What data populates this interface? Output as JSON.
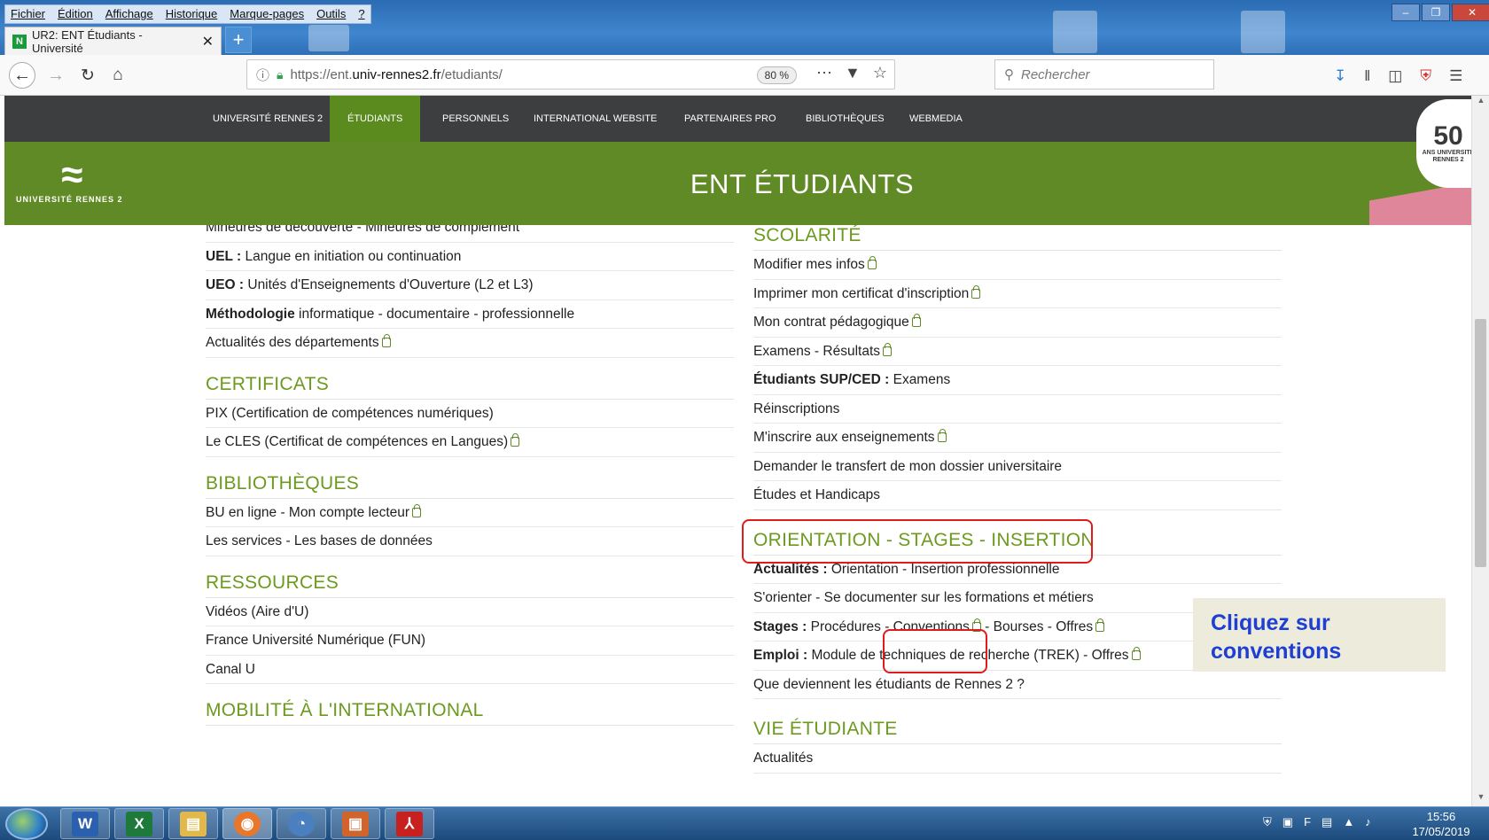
{
  "menu": [
    "Fichier",
    "Édition",
    "Affichage",
    "Historique",
    "Marque-pages",
    "Outils",
    "?"
  ],
  "tab": {
    "title": "UR2: ENT Étudiants - Université",
    "favicon": "N",
    "close": "✕"
  },
  "newtab": "+",
  "window_controls": [
    "–",
    "❐",
    "✕"
  ],
  "urlbar": {
    "scheme": "https://ent.",
    "host": "univ-rennes2.fr",
    "path": "/etudiants/",
    "zoom": "80 %"
  },
  "search_placeholder": "Rechercher",
  "sitenav": [
    "UNIVERSITÉ RENNES 2",
    "ÉTUDIANTS",
    "PERSONNELS",
    "INTERNATIONAL WEBSITE",
    "PARTENAIRES PRO",
    "BIBLIOTHÈQUES",
    "WEBMEDIA"
  ],
  "banner": {
    "title": "ENT ÉTUDIANTS",
    "logo_text": "UNIVERSITÉ RENNES 2",
    "badge_number": "50",
    "badge_text": "ANS UNIVERSITÉ RENNES 2"
  },
  "left": {
    "top_rows": [
      {
        "bold": "",
        "text": "Mineures de découverte - Mineures de complément",
        "lock": false
      },
      {
        "bold": "UEL :",
        "text": " Langue en initiation ou continuation",
        "lock": false
      },
      {
        "bold": "UEO :",
        "text": " Unités d'Enseignements d'Ouverture (L2 et L3)",
        "lock": false
      },
      {
        "bold": "Méthodologie",
        "text": " informatique - documentaire - professionnelle",
        "lock": false
      },
      {
        "bold": "",
        "text": "Actualités des départements",
        "lock": true
      }
    ],
    "certificats": {
      "heading": "CERTIFICATS",
      "rows": [
        {
          "bold": "",
          "text": "PIX (Certification de compétences numériques)",
          "lock": false
        },
        {
          "bold": "",
          "text": "Le CLES (Certificat de compétences en Langues)",
          "lock": true
        }
      ]
    },
    "bibliotheques": {
      "heading": "BIBLIOTHÈQUES",
      "rows": [
        {
          "bold": "",
          "text": "BU en ligne - Mon compte lecteur",
          "lock": true
        },
        {
          "bold": "",
          "text": "Les services - Les bases de données",
          "lock": false
        }
      ]
    },
    "ressources": {
      "heading": "RESSOURCES",
      "rows": [
        {
          "bold": "",
          "text": "Vidéos (Aire d'U)",
          "lock": false
        },
        {
          "bold": "",
          "text": "France Université Numérique (FUN)",
          "lock": false
        },
        {
          "bold": "",
          "text": "Canal U",
          "lock": false
        }
      ]
    },
    "mobilite": {
      "heading": "MOBILITÉ À L'INTERNATIONAL"
    }
  },
  "right": {
    "scolarite": {
      "heading": "SCOLARITÉ",
      "rows": [
        {
          "bold": "",
          "text": "Modifier mes infos",
          "lock": true
        },
        {
          "bold": "",
          "text": "Imprimer mon certificat d'inscription",
          "lock": true
        },
        {
          "bold": "",
          "text": "Mon contrat pédagogique",
          "lock": true
        },
        {
          "bold": "",
          "text": "Examens - Résultats",
          "lock": true
        },
        {
          "bold": "Étudiants SUP/CED :",
          "text": " Examens",
          "lock": false
        },
        {
          "bold": "",
          "text": "Réinscriptions",
          "lock": false
        },
        {
          "bold": "",
          "text": "M'inscrire aux enseignements",
          "lock": true
        },
        {
          "bold": "",
          "text": "Demander le transfert de mon dossier universitaire",
          "lock": false
        },
        {
          "bold": "",
          "text": "Études et Handicaps",
          "lock": false
        }
      ]
    },
    "orientation": {
      "heading": "ORIENTATION - STAGES - INSERTION",
      "rows": [
        {
          "bold": "Actualités :",
          "text": " Orientation - Insertion professionnelle",
          "lock": false
        },
        {
          "bold": "",
          "text": "S'orienter - Se documenter sur les formations et métiers",
          "lock": false
        }
      ],
      "stages": {
        "bold": "Stages :",
        "procedures": " Procédures - ",
        "conventions": "Conventions",
        "rest": " - Bourses - Offres"
      },
      "emploi": {
        "bold": "Emploi :",
        "text": " Module de techniques de recherche (TREK) - Offres"
      },
      "last": "Que deviennent les étudiants de Rennes 2 ?"
    },
    "vie": {
      "heading": "VIE ÉTUDIANTE",
      "rows": [
        {
          "bold": "",
          "text": "Actualités",
          "lock": false
        }
      ]
    }
  },
  "callout": "Cliquez sur conventions",
  "taskbar": {
    "apps": [
      "W",
      "X",
      "▤",
      "◉",
      "◔",
      "▣",
      "⅄"
    ],
    "time": "15:56",
    "date": "17/05/2019"
  },
  "colors": {
    "accent_green": "#5f8a25",
    "nav_dark": "#3c3e40",
    "heading_green": "#6c9a1f",
    "callout_blue": "#1f3fd4",
    "highlight_red": "#e01b1b"
  }
}
